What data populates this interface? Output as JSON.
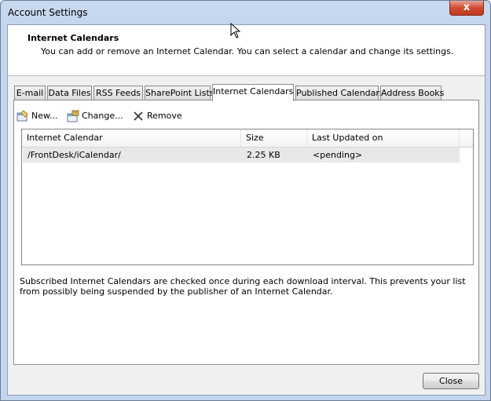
{
  "window": {
    "title": "Account Settings",
    "close_glyph": "x"
  },
  "header": {
    "title": "Internet Calendars",
    "description": "You can add or remove an Internet Calendar. You can select a calendar and change its settings."
  },
  "tabs": [
    {
      "label": "E-mail"
    },
    {
      "label": "Data Files"
    },
    {
      "label": "RSS Feeds"
    },
    {
      "label": "SharePoint Lists"
    },
    {
      "label": "Internet Calendars"
    },
    {
      "label": "Published Calendars"
    },
    {
      "label": "Address Books"
    }
  ],
  "active_tab": "Internet Calendars",
  "toolbar": {
    "new_label": "New...",
    "change_label": "Change...",
    "remove_label": "Remove"
  },
  "list": {
    "columns": [
      "Internet Calendar",
      "Size",
      "Last Updated on"
    ],
    "rows": [
      {
        "calendar": "/FrontDesk/iCalendar/",
        "size": "2.25 KB",
        "updated": "<pending>"
      }
    ]
  },
  "info_text": "Subscribed Internet Calendars are checked once during each download interval. This prevents your list from possibly being suspended by the publisher of an Internet Calendar.",
  "buttons": {
    "close_label": "Close"
  },
  "icons": {
    "new": "new-calendar-icon",
    "change": "change-settings-icon",
    "remove": "remove-x-icon",
    "cursor": "mouse-pointer-icon"
  }
}
